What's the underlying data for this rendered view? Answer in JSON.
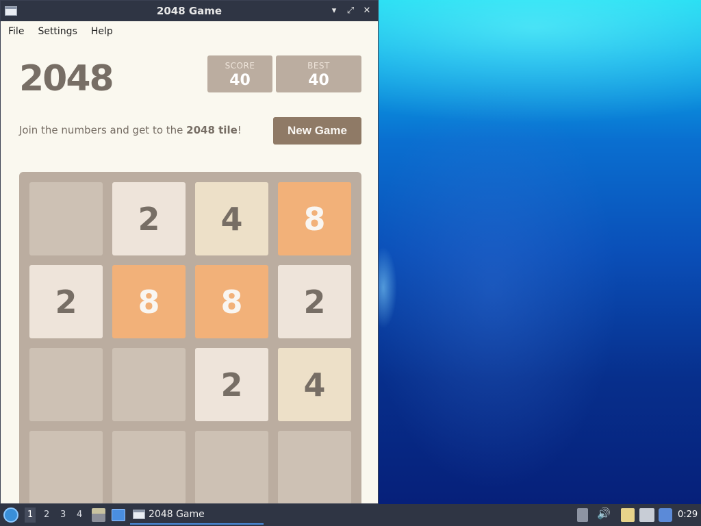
{
  "window": {
    "title": "2048 Game",
    "controls": {
      "minimize": "▾",
      "maximize": "⤢",
      "close": "✕"
    },
    "menu": [
      "File",
      "Settings",
      "Help"
    ]
  },
  "game": {
    "title": "2048",
    "score_label": "SCORE",
    "score_value": "40",
    "best_label": "BEST",
    "best_value": "40",
    "intro_prefix": "Join the numbers and get to the ",
    "intro_bold": "2048 tile",
    "intro_suffix": "!",
    "new_game_label": "New Game",
    "grid": [
      [
        "",
        "2",
        "4",
        "8"
      ],
      [
        "2",
        "8",
        "8",
        "2"
      ],
      [
        "",
        "",
        "2",
        "4"
      ],
      [
        "",
        "",
        "",
        ""
      ]
    ],
    "tile_colors": {
      "2": "#eee4da",
      "4": "#ede0c8",
      "8": "#f2b179",
      "empty": "#cdc1b4"
    }
  },
  "taskbar": {
    "workspaces": [
      "1",
      "2",
      "3",
      "4"
    ],
    "active_workspace": "1",
    "task_label": "2048 Game",
    "clock": "0:29",
    "icons": [
      "start-menu-icon",
      "file-manager-icon",
      "show-desktop-icon",
      "eject-icon",
      "volume-icon",
      "clipboard-icon",
      "network-icon",
      "notification-icon"
    ]
  }
}
